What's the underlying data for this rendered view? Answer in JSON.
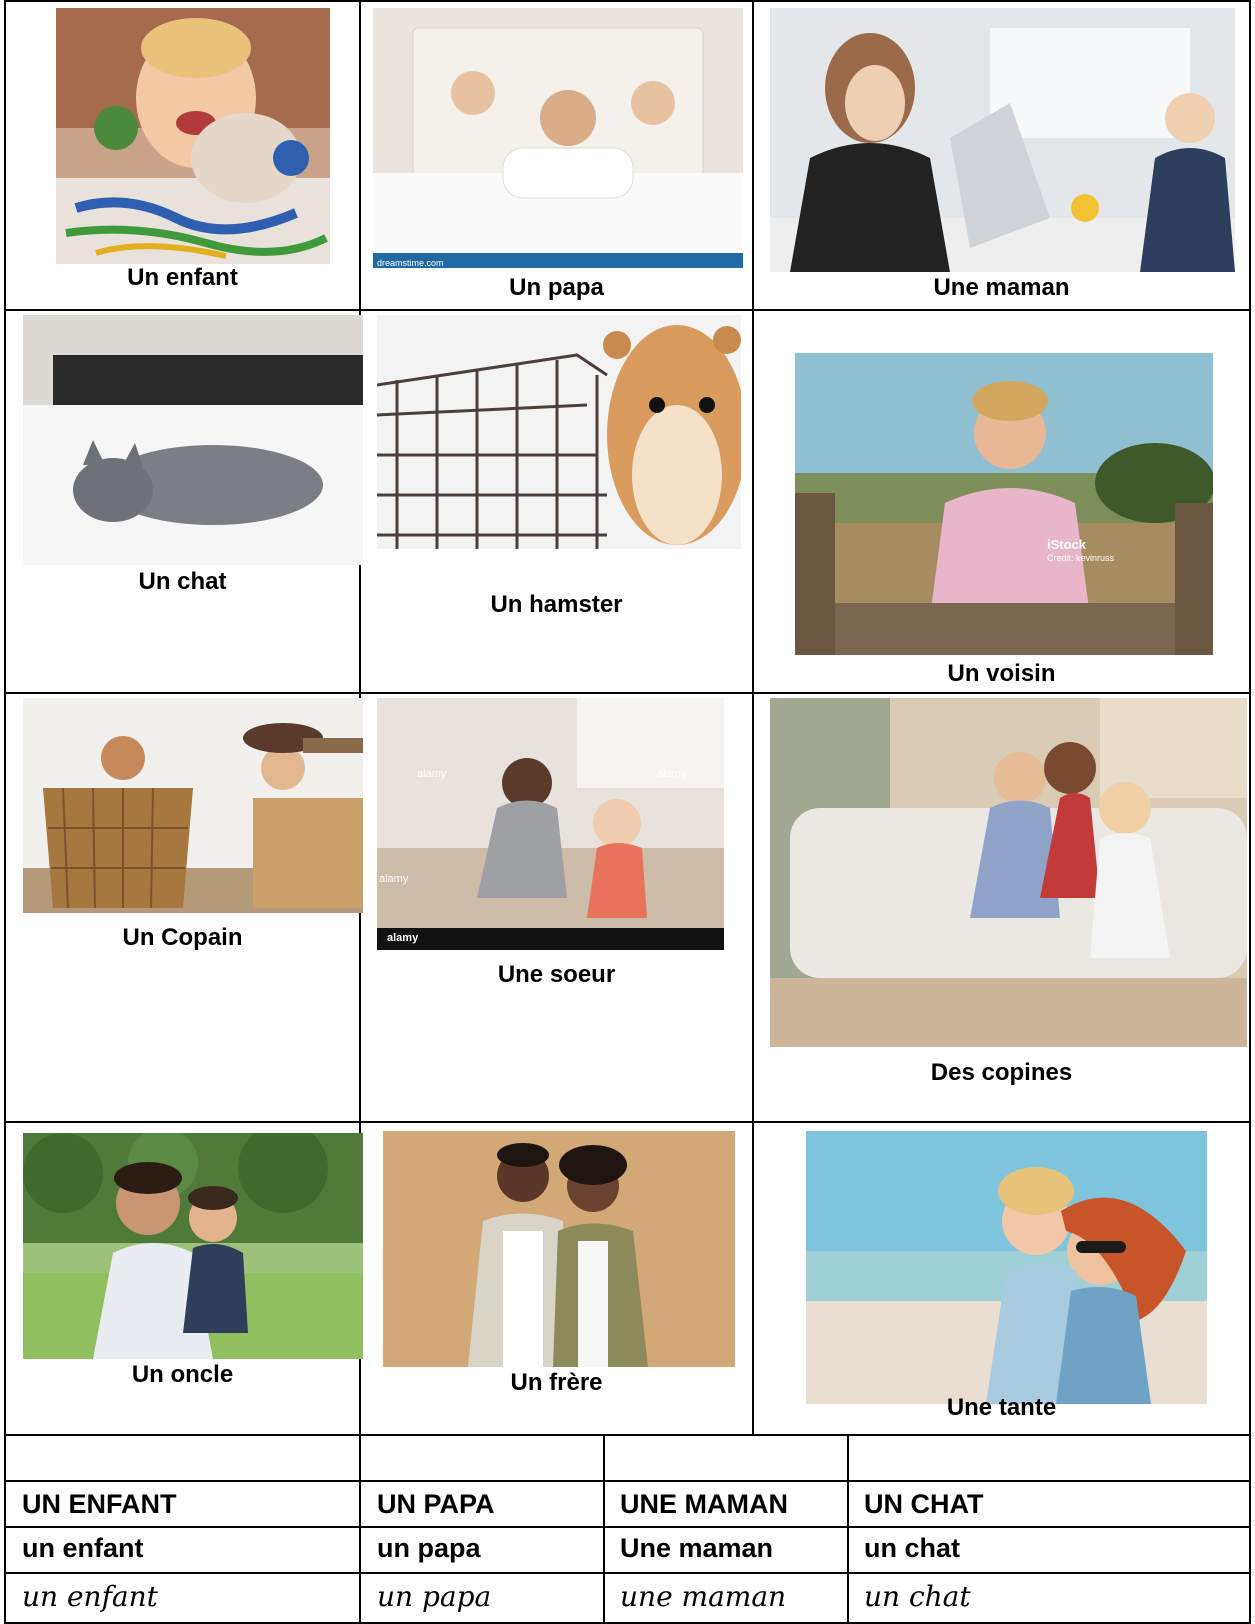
{
  "cards": [
    {
      "label": "Un enfant",
      "icon": "child-painting-photo"
    },
    {
      "label": "Un papa",
      "icon": "father-with-kids-photo"
    },
    {
      "label": "Une maman",
      "icon": "mother-laptop-photo"
    },
    {
      "label": "Un chat",
      "icon": "cat-on-bed-photo"
    },
    {
      "label": "Un hamster",
      "icon": "hamster-cage-photo"
    },
    {
      "label": "Un voisin",
      "icon": "neighbor-fence-photo"
    },
    {
      "label": "Un Copain",
      "icon": "friends-boxes-photo"
    },
    {
      "label": "Une soeur",
      "icon": "sister-baby-photo"
    },
    {
      "label": "Des copines",
      "icon": "girlfriends-sofa-photo"
    },
    {
      "label": "Un oncle",
      "icon": "uncle-piggyback-photo"
    },
    {
      "label": "Un frère",
      "icon": "brothers-photo"
    },
    {
      "label": "Une tante",
      "icon": "aunt-beach-photo"
    }
  ],
  "watermarks": {
    "papa": "dreamstime.com",
    "voisin_brand": "iStock",
    "voisin_credit": "Credit: kevinruss",
    "soeur_1": "alamy",
    "soeur_2": "alamy",
    "soeur_3": "alamy",
    "soeur_bar": "alamy"
  },
  "words": {
    "upper": [
      "UN ENFANT",
      "UN PAPA",
      "UNE MAMAN",
      "UN CHAT"
    ],
    "lower": [
      "un enfant",
      "un papa",
      "Une maman",
      "un chat"
    ],
    "cursive": [
      "un enfant",
      "un papa",
      "une maman",
      "un chat"
    ]
  }
}
